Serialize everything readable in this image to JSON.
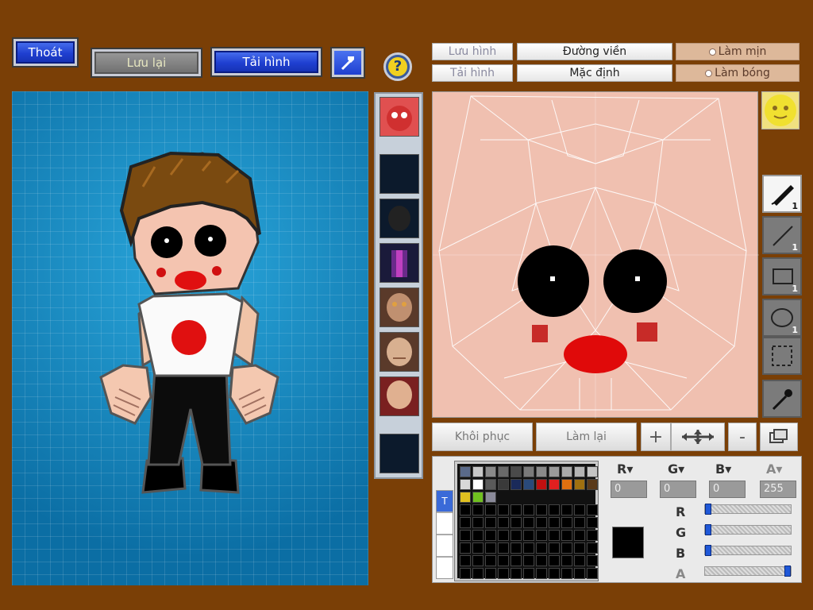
{
  "toolbar": {
    "exit_label": "Thoát",
    "save_label": "Lưu lại",
    "load_label": "Tải hình",
    "help_icon": "help-icon",
    "tools_icon": "hammer-icon"
  },
  "editor_tabs": {
    "save_image": "Lưu hình",
    "load_image": "Tải hình",
    "outline": "Đường viền",
    "default": "Mặc định",
    "smooth": "Làm mịn",
    "shade": "Làm bóng"
  },
  "tools": [
    {
      "name": "pen-tool",
      "size": "1"
    },
    {
      "name": "line-tool",
      "size": "1"
    },
    {
      "name": "rectangle-tool",
      "size": "1"
    },
    {
      "name": "ellipse-tool",
      "size": "1"
    },
    {
      "name": "select-tool",
      "size": ""
    },
    {
      "name": "eyedropper-tool",
      "size": ""
    }
  ],
  "actions": {
    "restore": "Khôi phục",
    "redo": "Làm lại",
    "zoom_in": "+",
    "move": "move-icon",
    "zoom_out": "-",
    "layers": "layers-icon"
  },
  "color": {
    "r_label": "R",
    "g_label": "G",
    "b_label": "B",
    "a_label": "A",
    "r": "0",
    "g": "0",
    "b": "0",
    "a": "255",
    "current": "#000000",
    "swatches_row1": [
      "#5a6a8a",
      "#c8c8c8",
      "#8a8a8a",
      "#6a6a6a",
      "#4a4a4a",
      "#7a7a7a",
      "#8a8a8a",
      "#9a9a9a",
      "#aaaaaa",
      "#b4b4b4",
      "#c4c4c4"
    ],
    "swatches_row2": [
      "#d8d8d8",
      "#ffffff",
      "#5a5a5a",
      "#3a3a3a",
      "#1a2a5a",
      "#2a4a7a",
      "#c01010",
      "#e02020",
      "#e07010",
      "#a07010",
      "#5a3a1a"
    ],
    "swatches_row3": [
      "#e0c020",
      "#70c020",
      "#8a8a9a"
    ]
  }
}
